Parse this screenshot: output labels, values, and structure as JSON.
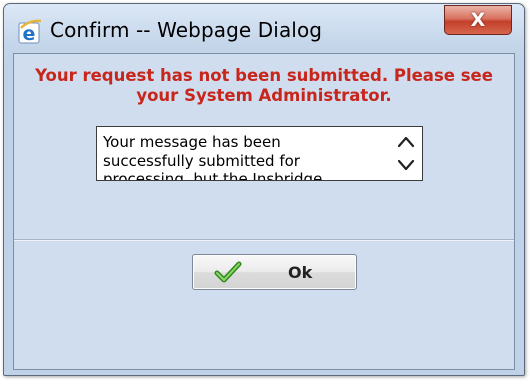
{
  "window": {
    "title": "Confirm -- Webpage Dialog",
    "title_icon": "ie-icon",
    "close_label": "X"
  },
  "dialog": {
    "error_line1": "Your request has not been submitted. Please see",
    "error_line2": "your System Administrator.",
    "message_lines": [
      "Your message has been",
      "successfully submitted for",
      "processing, but the Insbridge"
    ],
    "ok_label": "Ok",
    "ok_icon": "checkmark-icon"
  },
  "colors": {
    "error_text": "#c8251b",
    "client_bg": "#cfddef",
    "close_button": "#c3402b"
  }
}
